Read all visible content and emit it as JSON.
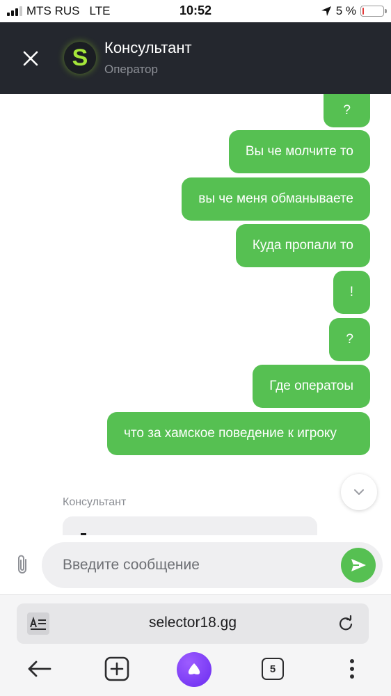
{
  "status_bar": {
    "carrier": "MTS RUS",
    "network": "LTE",
    "time": "10:52",
    "battery_label": "5 %",
    "battery_level": 0.05,
    "signal_bars_active": 3,
    "signal_bars_total": 4
  },
  "header": {
    "title": "Консультант",
    "subtitle": "Оператор",
    "avatar_letter": "S",
    "close_icon": "close-icon"
  },
  "messages": [
    {
      "from": "user",
      "text": "?"
    },
    {
      "from": "user",
      "text": "Вы че молчите то"
    },
    {
      "from": "user",
      "text": "вы че меня обманываете"
    },
    {
      "from": "user",
      "text": "Куда пропали то"
    },
    {
      "from": "user",
      "text": "!"
    },
    {
      "from": "user",
      "text": "?"
    },
    {
      "from": "user",
      "text": "Где оператоы"
    },
    {
      "from": "user",
      "text": "что за хамское поведение к игроку"
    }
  ],
  "agent_reply": {
    "name": "Консультант"
  },
  "composer": {
    "placeholder": "Введите сообщение",
    "attach_icon": "paperclip-icon",
    "send_icon": "send-icon"
  },
  "browser": {
    "url": "selector18.gg",
    "tabs_count": "5",
    "icons": [
      "reader-mode-icon",
      "reload-icon",
      "back-arrow-icon",
      "new-tab-icon",
      "alice-icon",
      "tabs-icon",
      "more-icon"
    ]
  },
  "colors": {
    "header_bg": "#24272e",
    "bubble_green": "#56c052",
    "avatar_accent": "#a5e63a",
    "alice_purple": "#7b3cf5"
  }
}
